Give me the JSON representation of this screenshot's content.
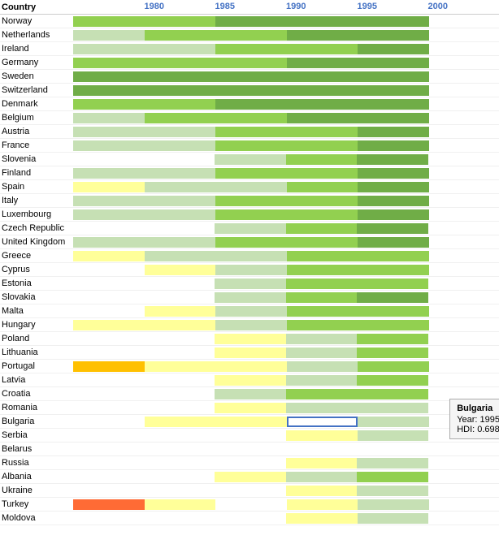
{
  "header": {
    "country_label": "Country",
    "year_labels": [
      {
        "year": "1980",
        "left_pct": 16.7
      },
      {
        "year": "1985",
        "left_pct": 33.3
      },
      {
        "year": "1990",
        "left_pct": 50.0
      },
      {
        "year": "1995",
        "left_pct": 66.7
      },
      {
        "year": "2000",
        "left_pct": 83.3
      }
    ]
  },
  "colors": {
    "green_dark": "#70ad47",
    "green_light": "#c6e0b4",
    "yellow": "#ffff99",
    "yellow_orange": "#ffe066",
    "orange": "#ffc000",
    "orange_red": "#ff9900",
    "red_orange": "#ff6600",
    "red": "#ff3333",
    "white": "#ffffff",
    "blue_outline": "#4472C4"
  },
  "tooltip": {
    "country": "Bulgaria",
    "year_label": "Year:",
    "year_value": "1995",
    "hdi_label": "HDI:",
    "hdi_value": "0.698"
  },
  "rows": [
    {
      "country": "Norway",
      "segments": [
        {
          "color": "#92d050",
          "width_pct": 16.7
        },
        {
          "color": "#92d050",
          "width_pct": 16.7
        },
        {
          "color": "#70ad47",
          "width_pct": 16.7
        },
        {
          "color": "#70ad47",
          "width_pct": 16.7
        },
        {
          "color": "#70ad47",
          "width_pct": 16.7
        }
      ],
      "start_pct": 0
    },
    {
      "country": "Netherlands",
      "segments": [
        {
          "color": "#c6e0b4",
          "width_pct": 16.7
        },
        {
          "color": "#92d050",
          "width_pct": 16.7
        },
        {
          "color": "#92d050",
          "width_pct": 16.7
        },
        {
          "color": "#70ad47",
          "width_pct": 16.7
        },
        {
          "color": "#70ad47",
          "width_pct": 16.7
        }
      ],
      "start_pct": 0
    },
    {
      "country": "Ireland",
      "segments": [
        {
          "color": "#c6e0b4",
          "width_pct": 16.7
        },
        {
          "color": "#c6e0b4",
          "width_pct": 16.7
        },
        {
          "color": "#92d050",
          "width_pct": 16.7
        },
        {
          "color": "#92d050",
          "width_pct": 16.7
        },
        {
          "color": "#70ad47",
          "width_pct": 16.7
        }
      ],
      "start_pct": 0
    },
    {
      "country": "Germany",
      "segments": [
        {
          "color": "#92d050",
          "width_pct": 16.7
        },
        {
          "color": "#92d050",
          "width_pct": 16.7
        },
        {
          "color": "#92d050",
          "width_pct": 16.7
        },
        {
          "color": "#70ad47",
          "width_pct": 16.7
        },
        {
          "color": "#70ad47",
          "width_pct": 16.7
        }
      ],
      "start_pct": 0
    },
    {
      "country": "Sweden",
      "segments": [
        {
          "color": "#70ad47",
          "width_pct": 16.7
        },
        {
          "color": "#70ad47",
          "width_pct": 16.7
        },
        {
          "color": "#70ad47",
          "width_pct": 16.7
        },
        {
          "color": "#70ad47",
          "width_pct": 16.7
        },
        {
          "color": "#70ad47",
          "width_pct": 16.7
        }
      ],
      "start_pct": 0
    },
    {
      "country": "Switzerland",
      "segments": [
        {
          "color": "#70ad47",
          "width_pct": 16.7
        },
        {
          "color": "#70ad47",
          "width_pct": 16.7
        },
        {
          "color": "#70ad47",
          "width_pct": 16.7
        },
        {
          "color": "#70ad47",
          "width_pct": 16.7
        },
        {
          "color": "#70ad47",
          "width_pct": 16.7
        }
      ],
      "start_pct": 0
    },
    {
      "country": "Denmark",
      "segments": [
        {
          "color": "#92d050",
          "width_pct": 16.7
        },
        {
          "color": "#92d050",
          "width_pct": 16.7
        },
        {
          "color": "#70ad47",
          "width_pct": 16.7
        },
        {
          "color": "#70ad47",
          "width_pct": 16.7
        },
        {
          "color": "#70ad47",
          "width_pct": 16.7
        }
      ],
      "start_pct": 0
    },
    {
      "country": "Belgium",
      "segments": [
        {
          "color": "#c6e0b4",
          "width_pct": 16.7
        },
        {
          "color": "#92d050",
          "width_pct": 16.7
        },
        {
          "color": "#92d050",
          "width_pct": 16.7
        },
        {
          "color": "#70ad47",
          "width_pct": 16.7
        },
        {
          "color": "#70ad47",
          "width_pct": 16.7
        }
      ],
      "start_pct": 0
    },
    {
      "country": "Austria",
      "segments": [
        {
          "color": "#c6e0b4",
          "width_pct": 16.7
        },
        {
          "color": "#c6e0b4",
          "width_pct": 16.7
        },
        {
          "color": "#92d050",
          "width_pct": 16.7
        },
        {
          "color": "#92d050",
          "width_pct": 16.7
        },
        {
          "color": "#70ad47",
          "width_pct": 16.7
        }
      ],
      "start_pct": 0
    },
    {
      "country": "France",
      "segments": [
        {
          "color": "#c6e0b4",
          "width_pct": 16.7
        },
        {
          "color": "#c6e0b4",
          "width_pct": 16.7
        },
        {
          "color": "#92d050",
          "width_pct": 16.7
        },
        {
          "color": "#92d050",
          "width_pct": 16.7
        },
        {
          "color": "#70ad47",
          "width_pct": 16.7
        }
      ],
      "start_pct": 0
    },
    {
      "country": "Slovenia",
      "segments": [
        {
          "color": "#ffffff",
          "width_pct": 33.3
        },
        {
          "color": "#c6e0b4",
          "width_pct": 16.7
        },
        {
          "color": "#92d050",
          "width_pct": 16.7
        },
        {
          "color": "#70ad47",
          "width_pct": 16.7
        }
      ],
      "start_pct": 0
    },
    {
      "country": "Finland",
      "segments": [
        {
          "color": "#c6e0b4",
          "width_pct": 16.7
        },
        {
          "color": "#c6e0b4",
          "width_pct": 16.7
        },
        {
          "color": "#92d050",
          "width_pct": 16.7
        },
        {
          "color": "#92d050",
          "width_pct": 16.7
        },
        {
          "color": "#70ad47",
          "width_pct": 16.7
        }
      ],
      "start_pct": 0
    },
    {
      "country": "Spain",
      "segments": [
        {
          "color": "#ffff99",
          "width_pct": 16.7
        },
        {
          "color": "#c6e0b4",
          "width_pct": 16.7
        },
        {
          "color": "#c6e0b4",
          "width_pct": 16.7
        },
        {
          "color": "#92d050",
          "width_pct": 16.7
        },
        {
          "color": "#70ad47",
          "width_pct": 16.7
        }
      ],
      "start_pct": 0
    },
    {
      "country": "Italy",
      "segments": [
        {
          "color": "#c6e0b4",
          "width_pct": 16.7
        },
        {
          "color": "#c6e0b4",
          "width_pct": 16.7
        },
        {
          "color": "#92d050",
          "width_pct": 16.7
        },
        {
          "color": "#92d050",
          "width_pct": 16.7
        },
        {
          "color": "#70ad47",
          "width_pct": 16.7
        }
      ],
      "start_pct": 0
    },
    {
      "country": "Luxembourg",
      "segments": [
        {
          "color": "#c6e0b4",
          "width_pct": 16.7
        },
        {
          "color": "#c6e0b4",
          "width_pct": 16.7
        },
        {
          "color": "#92d050",
          "width_pct": 16.7
        },
        {
          "color": "#92d050",
          "width_pct": 16.7
        },
        {
          "color": "#70ad47",
          "width_pct": 16.7
        }
      ],
      "start_pct": 0
    },
    {
      "country": "Czech Republic",
      "segments": [
        {
          "color": "#ffffff",
          "width_pct": 33.3
        },
        {
          "color": "#c6e0b4",
          "width_pct": 16.7
        },
        {
          "color": "#92d050",
          "width_pct": 16.7
        },
        {
          "color": "#70ad47",
          "width_pct": 16.7
        }
      ],
      "start_pct": 0
    },
    {
      "country": "United Kingdom",
      "segments": [
        {
          "color": "#c6e0b4",
          "width_pct": 16.7
        },
        {
          "color": "#c6e0b4",
          "width_pct": 16.7
        },
        {
          "color": "#92d050",
          "width_pct": 16.7
        },
        {
          "color": "#92d050",
          "width_pct": 16.7
        },
        {
          "color": "#70ad47",
          "width_pct": 16.7
        }
      ],
      "start_pct": 0
    },
    {
      "country": "Greece",
      "segments": [
        {
          "color": "#ffff99",
          "width_pct": 16.7
        },
        {
          "color": "#c6e0b4",
          "width_pct": 16.7
        },
        {
          "color": "#c6e0b4",
          "width_pct": 16.7
        },
        {
          "color": "#92d050",
          "width_pct": 16.7
        },
        {
          "color": "#92d050",
          "width_pct": 16.7
        }
      ],
      "start_pct": 0
    },
    {
      "country": "Cyprus",
      "segments": [
        {
          "color": "#ffffff",
          "width_pct": 16.7
        },
        {
          "color": "#ffff99",
          "width_pct": 16.7
        },
        {
          "color": "#c6e0b4",
          "width_pct": 16.7
        },
        {
          "color": "#92d050",
          "width_pct": 16.7
        },
        {
          "color": "#92d050",
          "width_pct": 16.7
        }
      ],
      "start_pct": 0
    },
    {
      "country": "Estonia",
      "segments": [
        {
          "color": "#ffffff",
          "width_pct": 33.3
        },
        {
          "color": "#c6e0b4",
          "width_pct": 16.7
        },
        {
          "color": "#92d050",
          "width_pct": 16.7
        },
        {
          "color": "#92d050",
          "width_pct": 16.7
        }
      ],
      "start_pct": 0
    },
    {
      "country": "Slovakia",
      "segments": [
        {
          "color": "#ffffff",
          "width_pct": 33.3
        },
        {
          "color": "#c6e0b4",
          "width_pct": 16.7
        },
        {
          "color": "#92d050",
          "width_pct": 16.7
        },
        {
          "color": "#70ad47",
          "width_pct": 16.7
        }
      ],
      "start_pct": 0
    },
    {
      "country": "Malta",
      "segments": [
        {
          "color": "#ffffff",
          "width_pct": 16.7
        },
        {
          "color": "#ffff99",
          "width_pct": 16.7
        },
        {
          "color": "#c6e0b4",
          "width_pct": 16.7
        },
        {
          "color": "#92d050",
          "width_pct": 16.7
        },
        {
          "color": "#92d050",
          "width_pct": 16.7
        }
      ],
      "start_pct": 0
    },
    {
      "country": "Hungary",
      "segments": [
        {
          "color": "#ffff99",
          "width_pct": 16.7
        },
        {
          "color": "#ffff99",
          "width_pct": 16.7
        },
        {
          "color": "#c6e0b4",
          "width_pct": 16.7
        },
        {
          "color": "#92d050",
          "width_pct": 16.7
        },
        {
          "color": "#92d050",
          "width_pct": 16.7
        }
      ],
      "start_pct": 0
    },
    {
      "country": "Poland",
      "segments": [
        {
          "color": "#ffffff",
          "width_pct": 33.3
        },
        {
          "color": "#ffff99",
          "width_pct": 16.7
        },
        {
          "color": "#c6e0b4",
          "width_pct": 16.7
        },
        {
          "color": "#92d050",
          "width_pct": 16.7
        }
      ],
      "start_pct": 0
    },
    {
      "country": "Lithuania",
      "segments": [
        {
          "color": "#ffffff",
          "width_pct": 33.3
        },
        {
          "color": "#ffff99",
          "width_pct": 16.7
        },
        {
          "color": "#c6e0b4",
          "width_pct": 16.7
        },
        {
          "color": "#92d050",
          "width_pct": 16.7
        }
      ],
      "start_pct": 0
    },
    {
      "country": "Portugal",
      "segments": [
        {
          "color": "#ffc000",
          "width_pct": 16.7
        },
        {
          "color": "#ffff99",
          "width_pct": 16.7
        },
        {
          "color": "#ffff99",
          "width_pct": 16.7
        },
        {
          "color": "#c6e0b4",
          "width_pct": 16.7
        },
        {
          "color": "#92d050",
          "width_pct": 16.7
        }
      ],
      "start_pct": 0
    },
    {
      "country": "Latvia",
      "segments": [
        {
          "color": "#ffffff",
          "width_pct": 33.3
        },
        {
          "color": "#ffff99",
          "width_pct": 16.7
        },
        {
          "color": "#c6e0b4",
          "width_pct": 16.7
        },
        {
          "color": "#92d050",
          "width_pct": 16.7
        }
      ],
      "start_pct": 0
    },
    {
      "country": "Croatia",
      "segments": [
        {
          "color": "#ffffff",
          "width_pct": 33.3
        },
        {
          "color": "#c6e0b4",
          "width_pct": 16.7
        },
        {
          "color": "#92d050",
          "width_pct": 16.7
        },
        {
          "color": "#92d050",
          "width_pct": 16.7
        }
      ],
      "start_pct": 0
    },
    {
      "country": "Romania",
      "segments": [
        {
          "color": "#ffffff",
          "width_pct": 33.3
        },
        {
          "color": "#ffff99",
          "width_pct": 16.7
        },
        {
          "color": "#c6e0b4",
          "width_pct": 16.7
        },
        {
          "color": "#c6e0b4",
          "width_pct": 16.7
        }
      ],
      "start_pct": 0
    },
    {
      "country": "Bulgaria",
      "segments": [
        {
          "color": "#ffffff",
          "width_pct": 16.7
        },
        {
          "color": "#ffff99",
          "width_pct": 16.7
        },
        {
          "color": "#ffff99",
          "width_pct": 16.7
        },
        {
          "color": "#outline",
          "width_pct": 16.7
        },
        {
          "color": "#c6e0b4",
          "width_pct": 16.7
        }
      ],
      "start_pct": 0,
      "has_tooltip": true
    },
    {
      "country": "Serbia",
      "segments": [
        {
          "color": "#ffffff",
          "width_pct": 50.0
        },
        {
          "color": "#ffff99",
          "width_pct": 16.7
        },
        {
          "color": "#c6e0b4",
          "width_pct": 16.7
        }
      ],
      "start_pct": 0
    },
    {
      "country": "Belarus",
      "segments": [
        {
          "color": "#ffffff",
          "width_pct": 33.3
        },
        {
          "color": "#ffffff",
          "width_pct": 16.7
        },
        {
          "color": "#ffffff",
          "width_pct": 16.7
        },
        {
          "color": "#ffffff",
          "width_pct": 16.7
        }
      ],
      "start_pct": 0
    },
    {
      "country": "Russia",
      "segments": [
        {
          "color": "#ffffff",
          "width_pct": 33.3
        },
        {
          "color": "#ffffff",
          "width_pct": 16.7
        },
        {
          "color": "#ffff99",
          "width_pct": 16.7
        },
        {
          "color": "#c6e0b4",
          "width_pct": 16.7
        }
      ],
      "start_pct": 0
    },
    {
      "country": "Albania",
      "segments": [
        {
          "color": "#ffffff",
          "width_pct": 33.3
        },
        {
          "color": "#ffff99",
          "width_pct": 16.7
        },
        {
          "color": "#c6e0b4",
          "width_pct": 16.7
        },
        {
          "color": "#92d050",
          "width_pct": 16.7
        }
      ],
      "start_pct": 0
    },
    {
      "country": "Ukraine",
      "segments": [
        {
          "color": "#ffffff",
          "width_pct": 33.3
        },
        {
          "color": "#ffffff",
          "width_pct": 16.7
        },
        {
          "color": "#ffff99",
          "width_pct": 16.7
        },
        {
          "color": "#c6e0b4",
          "width_pct": 16.7
        }
      ],
      "start_pct": 0
    },
    {
      "country": "Turkey",
      "segments": [
        {
          "color": "#ff6b35",
          "width_pct": 16.7
        },
        {
          "color": "#ffff99",
          "width_pct": 16.7
        },
        {
          "color": "#ffffff",
          "width_pct": 16.7
        },
        {
          "color": "#ffff99",
          "width_pct": 16.7
        },
        {
          "color": "#c6e0b4",
          "width_pct": 16.7
        }
      ],
      "start_pct": 0
    },
    {
      "country": "Moldova",
      "segments": [
        {
          "color": "#ffffff",
          "width_pct": 50.0
        },
        {
          "color": "#ffff99",
          "width_pct": 16.7
        },
        {
          "color": "#c6e0b4",
          "width_pct": 16.7
        }
      ],
      "start_pct": 0
    }
  ]
}
